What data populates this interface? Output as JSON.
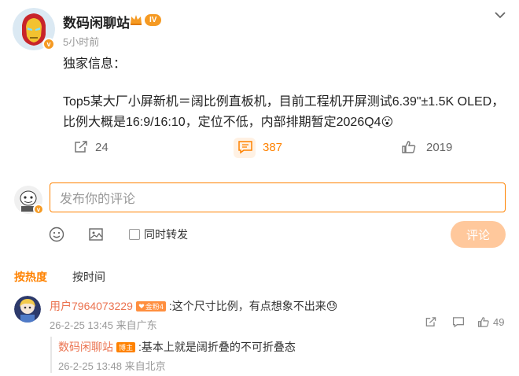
{
  "post": {
    "author": "数码闲聊站",
    "level_badge": "IV",
    "time": "5小时前",
    "line1": "独家信息：",
    "line2": "Top5某大厂小屏新机＝阔比例直板机，目前工程机开屏测试6.39\"±1.5K OLED，",
    "line3": "比例大概是16:9/16:10，定位不低，内部排期暂定2026Q4",
    "emoji": "😮",
    "actions": {
      "repost_count": "24",
      "comment_count": "387",
      "like_count": "2019"
    }
  },
  "composer": {
    "placeholder": "发布你的评论",
    "also_repost_label": "同时转发",
    "submit_label": "评论"
  },
  "sort_tabs": {
    "hot": "按热度",
    "time": "按时间"
  },
  "comment": {
    "user": "用户7964073229",
    "fan_badge": "金粉4",
    "text": ":这个尺寸比例，有点想象不出来😓",
    "time_location": "26-2-25 13:45 来自广东",
    "like_count": "49"
  },
  "reply": {
    "user": "数码闲聊站",
    "host_badge": "博主",
    "text": ":基本上就是阔折叠的不可折叠态",
    "time_location": "26-2-25 13:48 来自北京"
  },
  "colors": {
    "accent": "#ff8200",
    "name_link": "#eb7350",
    "verified": "#f59a23"
  }
}
